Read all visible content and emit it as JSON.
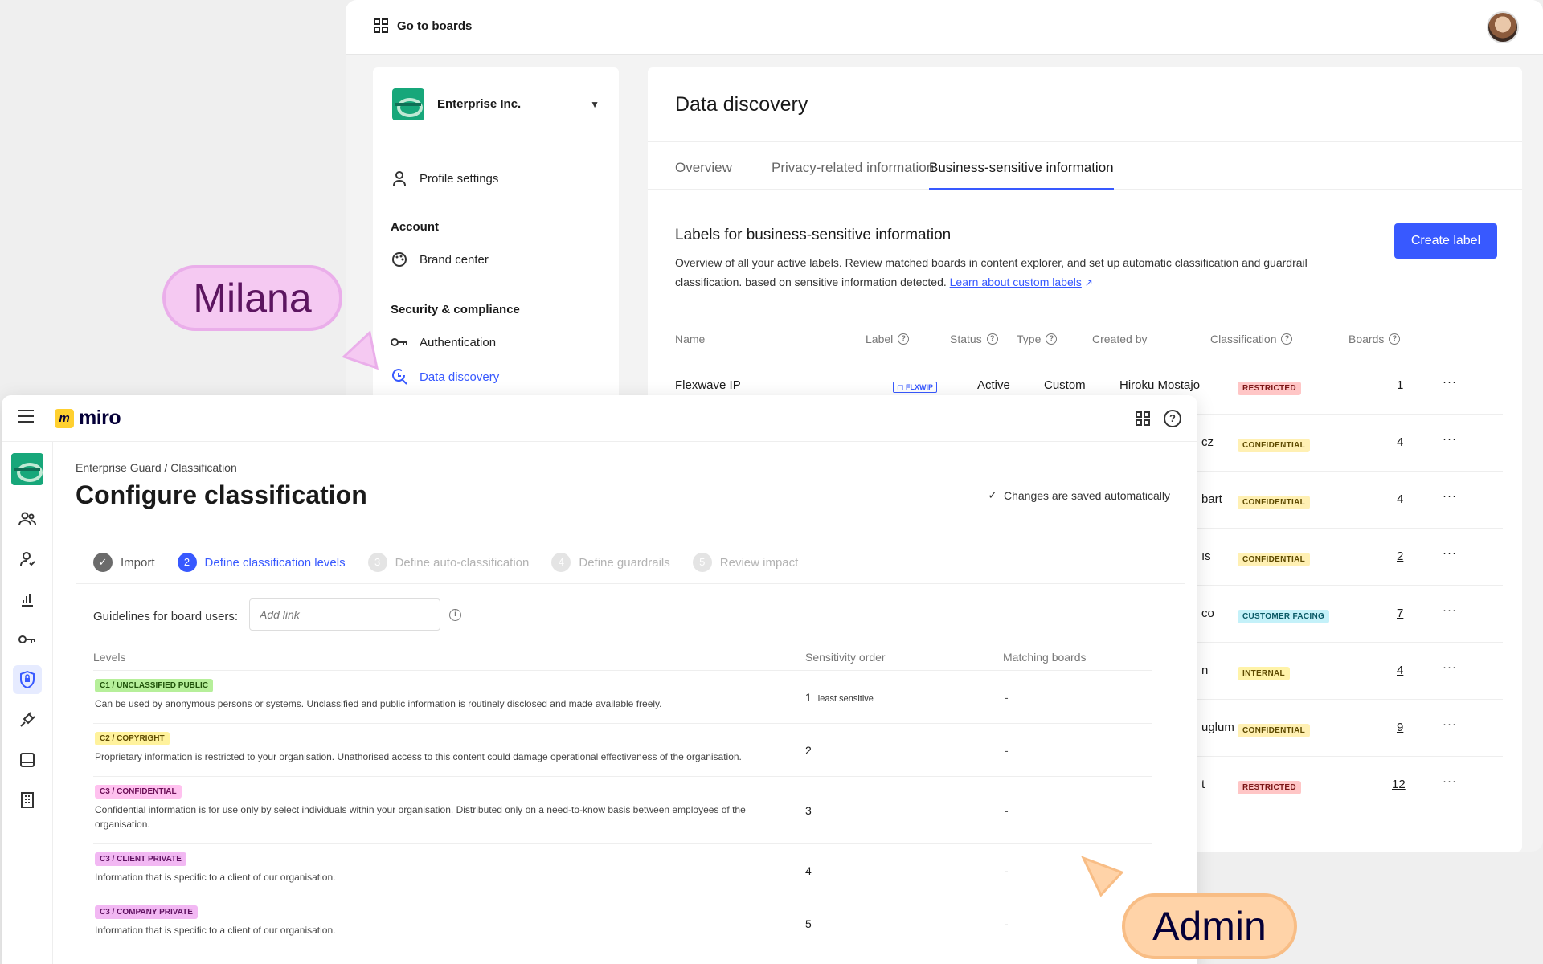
{
  "back": {
    "goto_boards": "Go to boards",
    "org_name": "Enterprise Inc.",
    "menu": {
      "profile": "Profile settings",
      "account_head": "Account",
      "brand": "Brand center",
      "security_head": "Security & compliance",
      "auth": "Authentication",
      "discovery": "Data discovery"
    },
    "main": {
      "title": "Data discovery",
      "tabs": [
        "Overview",
        "Privacy-related information",
        "Business-sensitive information"
      ],
      "labels_title": "Labels for business-sensitive information",
      "labels_desc": "Overview of all your active labels. Review matched boards in content explorer, and set up automatic classification and guardrail classification. based on sensitive information detected.",
      "learn_more": "Learn about custom labels",
      "create_label": "Create label",
      "columns": [
        "Name",
        "Label",
        "Status",
        "Type",
        "Created by",
        "Classification",
        "Boards"
      ],
      "rows": [
        {
          "name": "Flexwave IP",
          "label": "FLXWIP",
          "status": "Active",
          "type": "Custom",
          "created_by": "Hiroku Mostajo",
          "classification": "RESTRICTED",
          "boards": "1"
        },
        {
          "created_by": "cz",
          "classification": "CONFIDENTIAL",
          "boards": "4"
        },
        {
          "created_by": "bart",
          "classification": "CONFIDENTIAL",
          "boards": "4"
        },
        {
          "created_by": "ıs",
          "classification": "CONFIDENTIAL",
          "boards": "2"
        },
        {
          "created_by": "co",
          "classification": "CUSTOMER FACING",
          "boards": "7"
        },
        {
          "created_by": "n",
          "classification": "INTERNAL",
          "boards": "4"
        },
        {
          "created_by": "uglum",
          "classification": "CONFIDENTIAL",
          "boards": "9"
        },
        {
          "created_by": "t",
          "classification": "RESTRICTED",
          "boards": "12"
        }
      ]
    }
  },
  "front": {
    "brand": "miro",
    "breadcrumb": "Enterprise Guard / Classification",
    "title": "Configure classification",
    "saved": "Changes are saved automatically",
    "steps": [
      {
        "num": "✓",
        "label": "Import",
        "state": "done"
      },
      {
        "num": "2",
        "label": "Define classification levels",
        "state": "current"
      },
      {
        "num": "3",
        "label": "Define auto-classification",
        "state": "todo"
      },
      {
        "num": "4",
        "label": "Define guardrails",
        "state": "todo"
      },
      {
        "num": "5",
        "label": "Review impact",
        "state": "todo"
      }
    ],
    "guidelines_label": "Guidelines for board users:",
    "guidelines_placeholder": "Add link",
    "headers": {
      "levels": "Levels",
      "order": "Sensitivity order",
      "boards": "Matching boards"
    },
    "levels": [
      {
        "tag": "C1 / UNCLASSIFIED PUBLIC",
        "desc": "Can be used by anonymous persons or systems. Unclassified and public information is routinely disclosed and made available freely.",
        "order": "1",
        "order_note": "least sensitive",
        "boards": "-"
      },
      {
        "tag": "C2 / COPYRIGHT",
        "desc": "Proprietary information is restricted to your organisation. Unathorised access to this content could damage operational effectiveness of the organisation.",
        "order": "2",
        "boards": "-"
      },
      {
        "tag": "C3 / CONFIDENTIAL",
        "desc": "Confidential information is for use only by select individuals within your organisation. Distributed only on a need-to-know basis between employees of the organisation.",
        "order": "3",
        "boards": "-"
      },
      {
        "tag": "C3 / CLIENT PRIVATE",
        "desc": "Information that is specific to a client of our organisation.",
        "order": "4",
        "boards": "-"
      },
      {
        "tag": "C3 / COMPANY PRIVATE",
        "desc": "Information that is specific to a client of our organisation.",
        "order": "5",
        "boards": "-"
      }
    ]
  },
  "cursors": {
    "milana": "Milana",
    "admin": "Admin"
  },
  "colors": {
    "accent": "#3859ff",
    "milana": "#f5c9f2",
    "admin": "#ffd3a8"
  }
}
